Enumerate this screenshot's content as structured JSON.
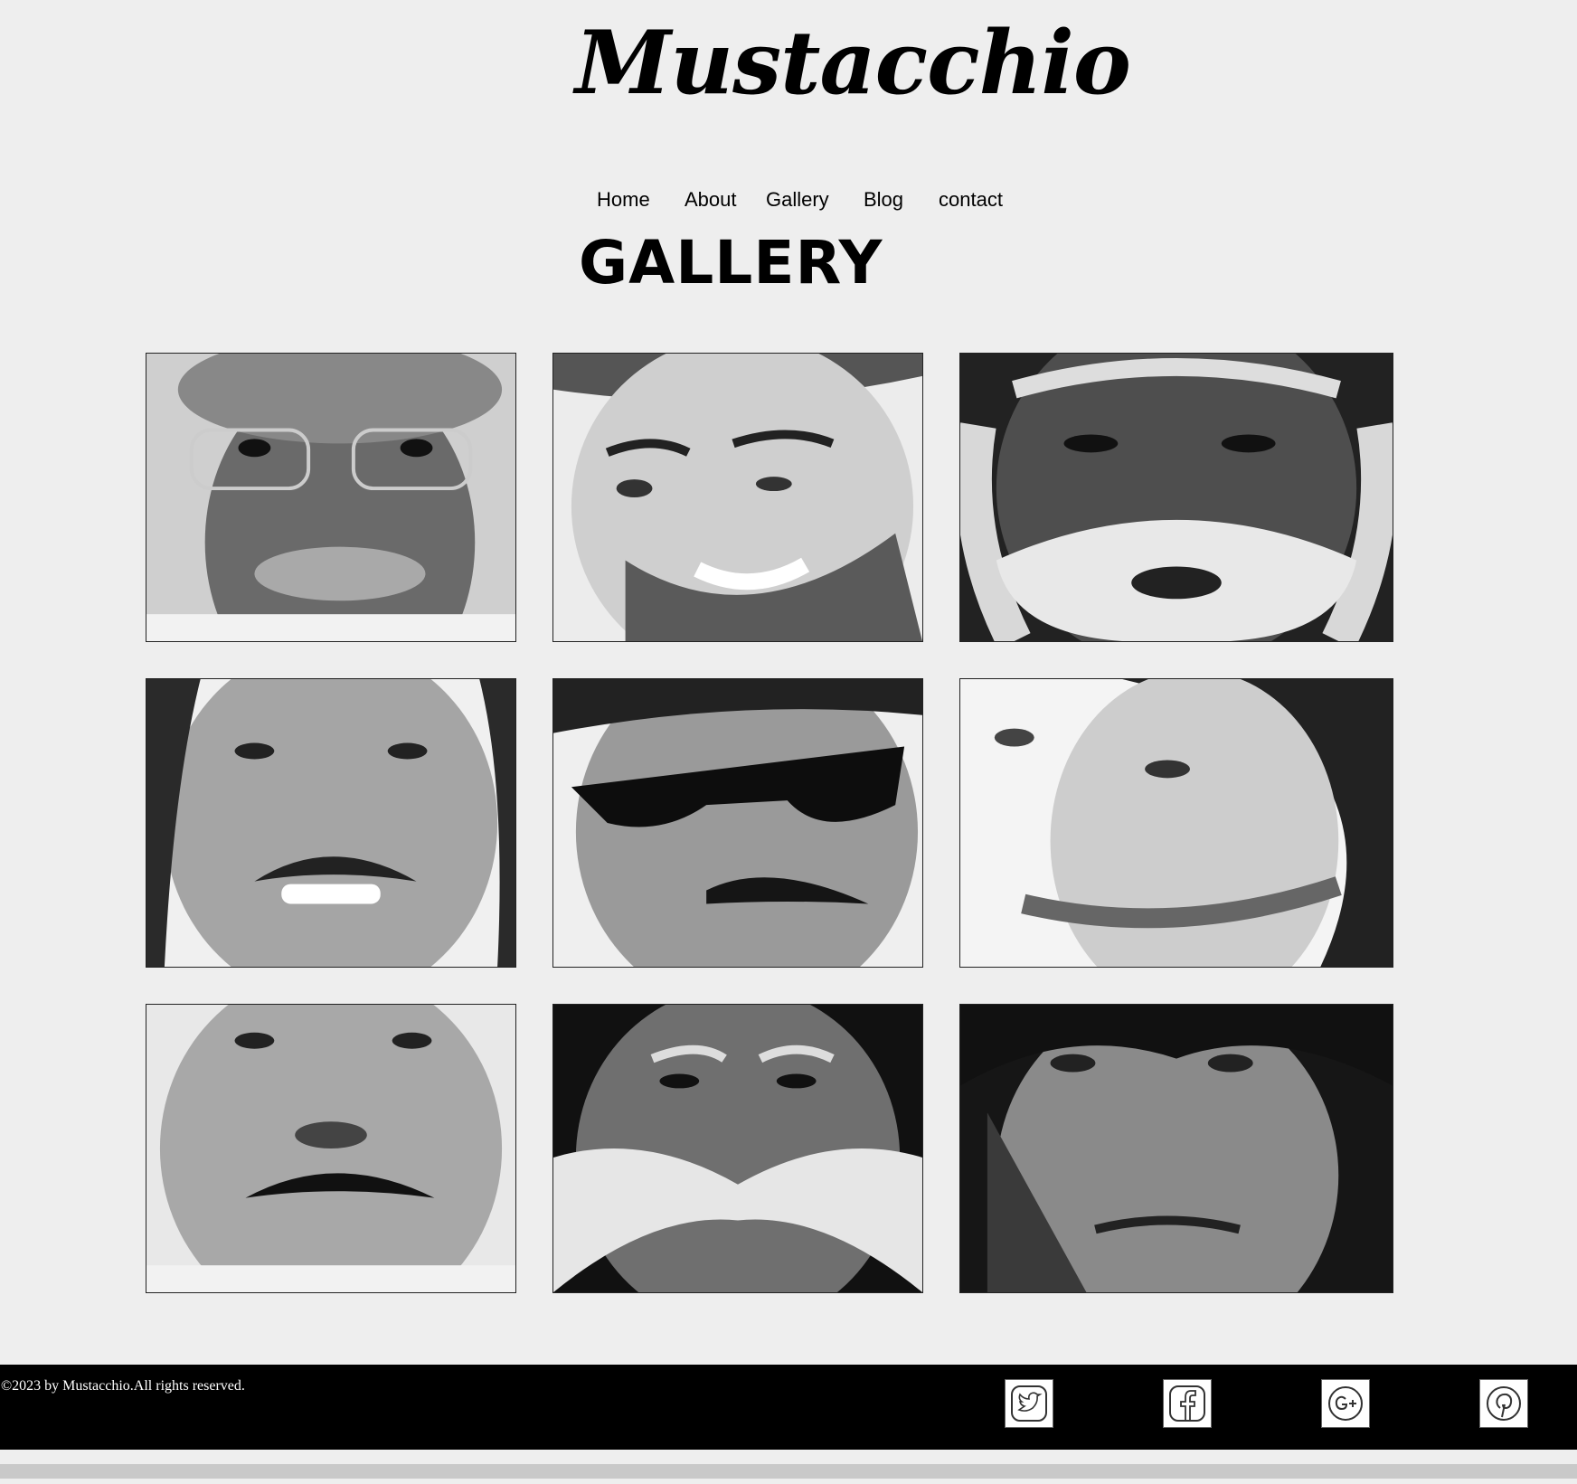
{
  "site": {
    "logo": "Mustacchio"
  },
  "nav": {
    "items": [
      "Home",
      "About",
      "Gallery",
      "Blog",
      "contact"
    ]
  },
  "page": {
    "title": "GALLERY"
  },
  "footer": {
    "copyright": "©2023 by Mustacchio.All rights reserved.",
    "social": [
      {
        "name": "twitter-icon"
      },
      {
        "name": "facebook-icon"
      },
      {
        "name": "google-plus-icon"
      },
      {
        "name": "pinterest-icon"
      }
    ]
  },
  "colors": {
    "page_bg": "#eeeeee",
    "footer_bg": "#000000",
    "text": "#000000",
    "footer_text": "#ffffff"
  }
}
